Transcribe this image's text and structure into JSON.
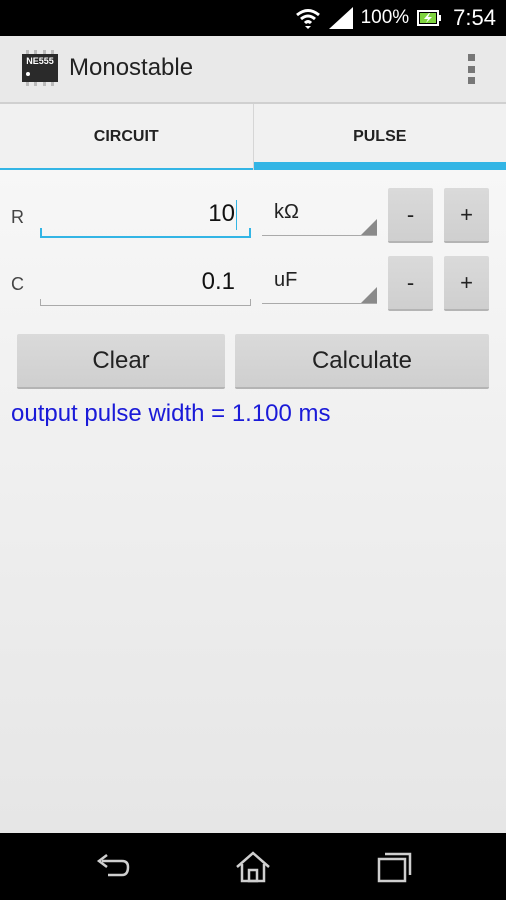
{
  "status_bar": {
    "battery": "100%",
    "time": "7:54",
    "icons": [
      "wifi-icon",
      "signal-icon",
      "battery-charging-icon"
    ]
  },
  "app": {
    "title": "Monostable",
    "icon_text": "NE555",
    "icon": "ic-chip-icon"
  },
  "tabs": [
    {
      "label": "CIRCUIT",
      "selected": false
    },
    {
      "label": "PULSE",
      "selected": true
    }
  ],
  "form": {
    "r": {
      "label": "R",
      "value": "10",
      "unit": "kΩ",
      "minus": "-",
      "plus": "+"
    },
    "c": {
      "label": "C",
      "value": "0.1",
      "unit": "uF",
      "minus": "-",
      "plus": "+"
    }
  },
  "buttons": {
    "clear": "Clear",
    "calculate": "Calculate"
  },
  "result": "output pulse width = 1.100 ms",
  "colors": {
    "accent": "#33b5e5",
    "result_text": "#1a1ad8"
  },
  "nav_bar": {
    "icons": [
      "back-icon",
      "home-icon",
      "recent-apps-icon"
    ]
  }
}
